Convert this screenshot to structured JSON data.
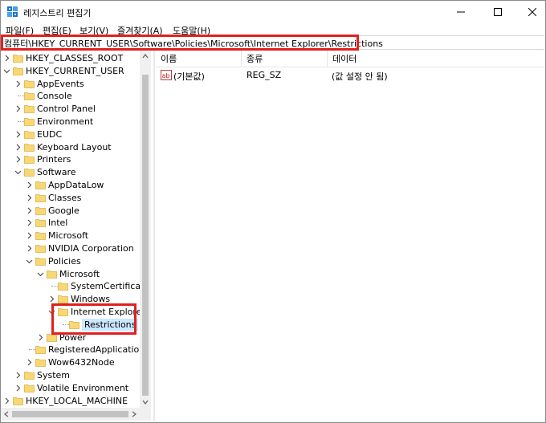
{
  "window": {
    "title": "레지스트리 편집기",
    "controls": {
      "minimize": "minimize",
      "maximize": "maximize",
      "close": "close"
    }
  },
  "menu": [
    "파일(F)",
    "편집(E)",
    "보기(V)",
    "즐겨찾기(A)",
    "도움말(H)"
  ],
  "address": "컴퓨터\\HKEY_CURRENT_USER\\Software\\Policies\\Microsoft\\Internet Explorer\\Restrictions",
  "tree": [
    {
      "label": "HKEY_CLASSES_ROOT",
      "level": 0,
      "expander": "collapsed"
    },
    {
      "label": "HKEY_CURRENT_USER",
      "level": 0,
      "expander": "expanded"
    },
    {
      "label": "AppEvents",
      "level": 1,
      "expander": "collapsed"
    },
    {
      "label": "Console",
      "level": 1,
      "expander": "none"
    },
    {
      "label": "Control Panel",
      "level": 1,
      "expander": "collapsed"
    },
    {
      "label": "Environment",
      "level": 1,
      "expander": "none"
    },
    {
      "label": "EUDC",
      "level": 1,
      "expander": "collapsed"
    },
    {
      "label": "Keyboard Layout",
      "level": 1,
      "expander": "collapsed"
    },
    {
      "label": "Printers",
      "level": 1,
      "expander": "collapsed"
    },
    {
      "label": "Software",
      "level": 1,
      "expander": "expanded"
    },
    {
      "label": "AppDataLow",
      "level": 2,
      "expander": "collapsed"
    },
    {
      "label": "Classes",
      "level": 2,
      "expander": "collapsed"
    },
    {
      "label": "Google",
      "level": 2,
      "expander": "collapsed"
    },
    {
      "label": "Intel",
      "level": 2,
      "expander": "collapsed"
    },
    {
      "label": "Microsoft",
      "level": 2,
      "expander": "collapsed"
    },
    {
      "label": "NVIDIA Corporation",
      "level": 2,
      "expander": "collapsed"
    },
    {
      "label": "Policies",
      "level": 2,
      "expander": "expanded"
    },
    {
      "label": "Microsoft",
      "level": 3,
      "expander": "expanded"
    },
    {
      "label": "SystemCertificates",
      "level": 4,
      "expander": "none"
    },
    {
      "label": "Windows",
      "level": 4,
      "expander": "collapsed"
    },
    {
      "label": "Internet Explorer",
      "level": 4,
      "expander": "expanded"
    },
    {
      "label": "Restrictions",
      "level": 5,
      "expander": "none",
      "selected": true
    },
    {
      "label": "Power",
      "level": 3,
      "expander": "collapsed"
    },
    {
      "label": "RegisteredApplications",
      "level": 2,
      "expander": "none"
    },
    {
      "label": "Wow6432Node",
      "level": 2,
      "expander": "collapsed"
    },
    {
      "label": "System",
      "level": 1,
      "expander": "collapsed"
    },
    {
      "label": "Volatile Environment",
      "level": 1,
      "expander": "collapsed"
    },
    {
      "label": "HKEY_LOCAL_MACHINE",
      "level": 0,
      "expander": "collapsed"
    }
  ],
  "list": {
    "columns": [
      "이름",
      "종류",
      "데이터"
    ],
    "rows": [
      {
        "name": "(기본값)",
        "type": "REG_SZ",
        "data": "(값 설정 안 됨)",
        "icon": "ab-string-icon"
      }
    ]
  },
  "colors": {
    "highlight": "#e02020",
    "selection": "#cce8ff",
    "folder": "#f8d775"
  }
}
